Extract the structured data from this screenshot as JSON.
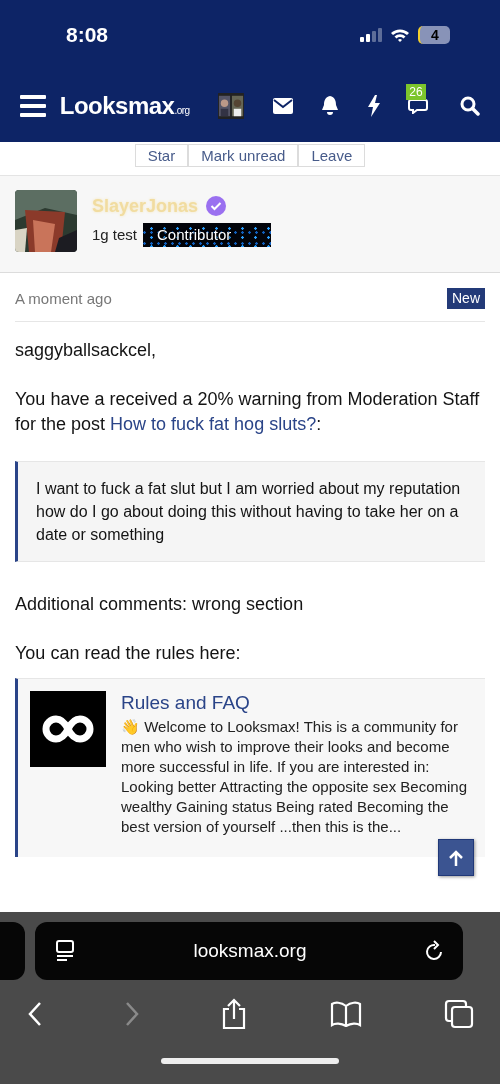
{
  "status_bar": {
    "time": "8:08",
    "battery": "4"
  },
  "nav": {
    "logo": "Looksmax",
    "logo_suffix": ".org",
    "chat_badge": "26"
  },
  "thread_buttons": [
    "Star",
    "Mark unread",
    "Leave"
  ],
  "author": {
    "name": "SlayerJonas",
    "verified": true,
    "title": "1g test",
    "badge": "Contributor"
  },
  "message": {
    "time": "A moment ago",
    "new_label": "New",
    "greeting": "saggyballsackcel,",
    "warning_text": "You have a received a 20% warning from Moderation Staff for the post",
    "warning_link": "How to fuck fat hog sluts?",
    "warning_end": ":",
    "quote": "I want to fuck a fat slut but I am worried about my reputation how do I go about doing this without having to take her on a date or something",
    "comments": "Additional comments: wrong section",
    "rules_intro": "You can read the rules here:",
    "embed": {
      "title": "Rules and FAQ",
      "text": "👋 Welcome to Looksmax! This is a community for men who wish to improve their looks and become more successful in life. If you are interested in: Looking better Attracting the opposite sex Becoming wealthy Gaining status Being rated Becoming the best version of yourself ...then this is the..."
    }
  },
  "browser": {
    "url": "looksmax.org",
    "forward_disabled": true
  }
}
